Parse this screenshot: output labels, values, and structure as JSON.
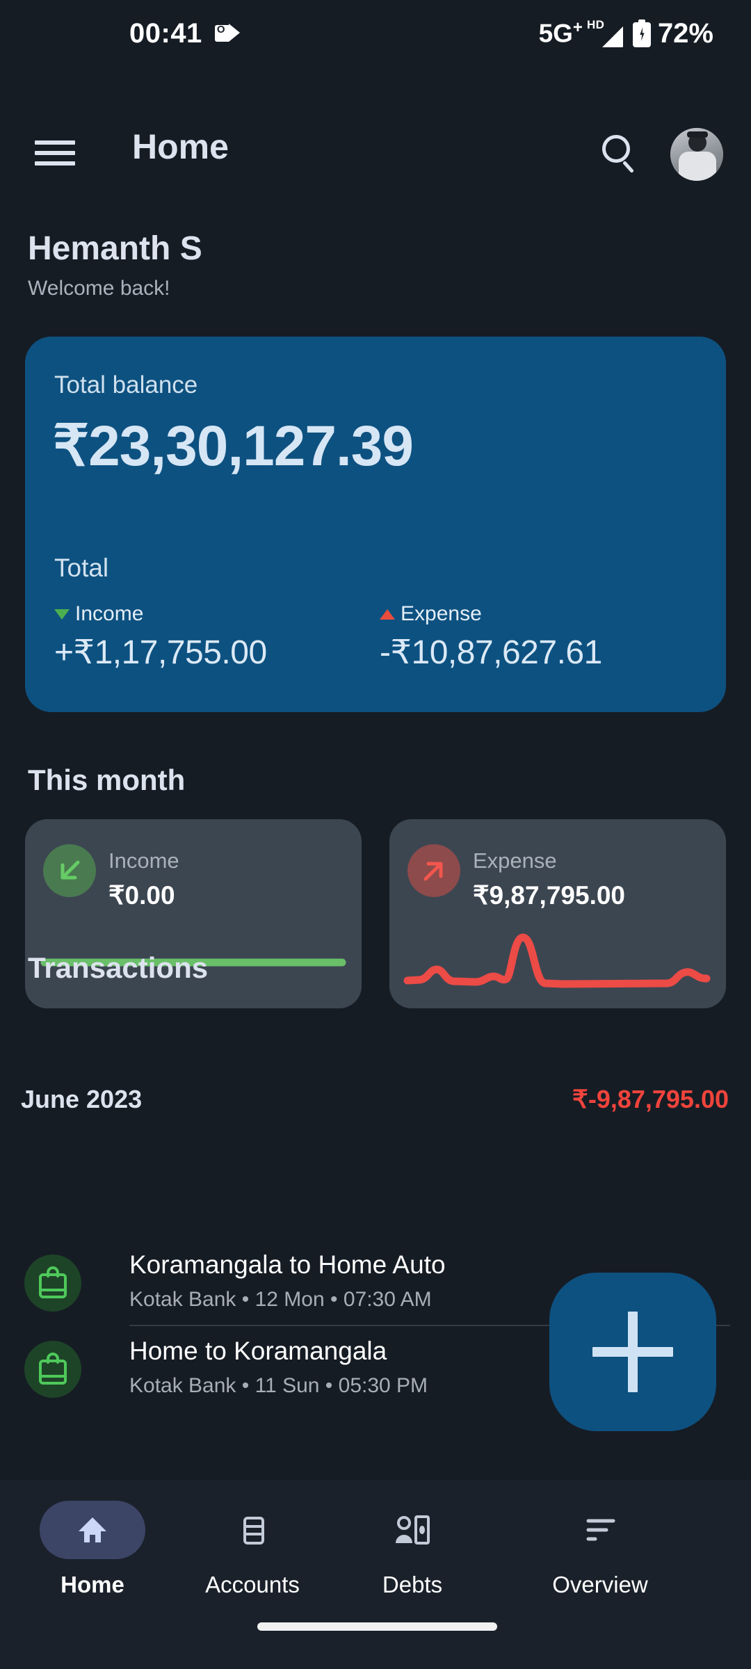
{
  "status_bar": {
    "time": "00:41",
    "notification_icon": "outlook-icon",
    "network": "5G",
    "network_plus": "+",
    "hd_label": "HD",
    "battery_percent": "72%"
  },
  "app_bar": {
    "menu_icon": "hamburger-menu-icon",
    "title": "Home",
    "search_icon": "search-icon",
    "avatar_icon": "user-avatar"
  },
  "greeting": {
    "name": "Hemanth S",
    "subtitle": "Welcome back!"
  },
  "balance_card": {
    "label": "Total balance",
    "amount": "₹23,30,127.39",
    "total_label": "Total",
    "income_label": "Income",
    "income_value": "+₹1,17,755.00",
    "expense_label": "Expense",
    "expense_value": "-₹10,87,627.61",
    "card_color": "#0d5180",
    "income_arrow_color": "#4caf50",
    "expense_arrow_color": "#e84c3d"
  },
  "this_month": {
    "title": "This month",
    "cards": [
      {
        "label": "Income",
        "value": "₹0.00",
        "icon": "arrow-down-left-icon",
        "badge_color": "#4a7a50",
        "line_color": "#6abf69"
      },
      {
        "label": "Expense",
        "value": "₹9,87,795.00",
        "icon": "arrow-up-right-icon",
        "badge_color": "#8d4b4b",
        "line_color": "#ec4b46"
      }
    ]
  },
  "transactions": {
    "title": "Transactions",
    "month_label": "June 2023",
    "month_total": "₹-9,87,795.00",
    "month_total_color": "#f0443c",
    "items": [
      {
        "name": "Koramangala to Home Auto",
        "meta": "Kotak Bank  • 12 Mon • 07:30 AM",
        "amount": "",
        "icon": "shopping-bag-icon"
      },
      {
        "name": "Home to Koramangala",
        "meta": "Kotak Bank  • 11 Sun • 05:30 PM",
        "amount": "",
        "icon": "shopping-bag-icon"
      }
    ]
  },
  "fab": {
    "icon": "plus-icon",
    "color": "#0d5180"
  },
  "bottom_nav": {
    "items": [
      {
        "label": "Home",
        "icon": "home-icon",
        "active": true
      },
      {
        "label": "Accounts",
        "icon": "credit-card-icon",
        "active": false
      },
      {
        "label": "Debts",
        "icon": "person-money-icon",
        "active": false
      },
      {
        "label": "Overview",
        "icon": "bar-chart-icon",
        "active": false
      }
    ]
  },
  "chart_data": [
    {
      "type": "line",
      "title": "Income this month",
      "series": [
        {
          "name": "Income",
          "values": [
            0,
            0,
            0,
            0,
            0,
            0,
            0,
            0,
            0,
            0,
            0,
            0
          ]
        }
      ],
      "x": [
        1,
        2,
        3,
        4,
        5,
        6,
        7,
        8,
        9,
        10,
        11,
        12
      ],
      "ylim": [
        0,
        1
      ],
      "color": "#6abf69",
      "grid": false,
      "legend": "none"
    },
    {
      "type": "line",
      "title": "Expense this month",
      "series": [
        {
          "name": "Expense",
          "values": [
            2,
            2,
            6,
            3,
            2,
            2,
            3,
            5,
            26,
            4,
            2,
            2,
            2,
            2,
            2,
            2,
            3,
            8,
            5
          ]
        }
      ],
      "x": [
        1,
        2,
        3,
        4,
        5,
        6,
        7,
        8,
        9,
        10,
        11,
        12,
        13,
        14,
        15,
        16,
        17,
        18,
        19
      ],
      "ylim": [
        0,
        28
      ],
      "color": "#ec4b46",
      "grid": false,
      "legend": "none"
    }
  ]
}
